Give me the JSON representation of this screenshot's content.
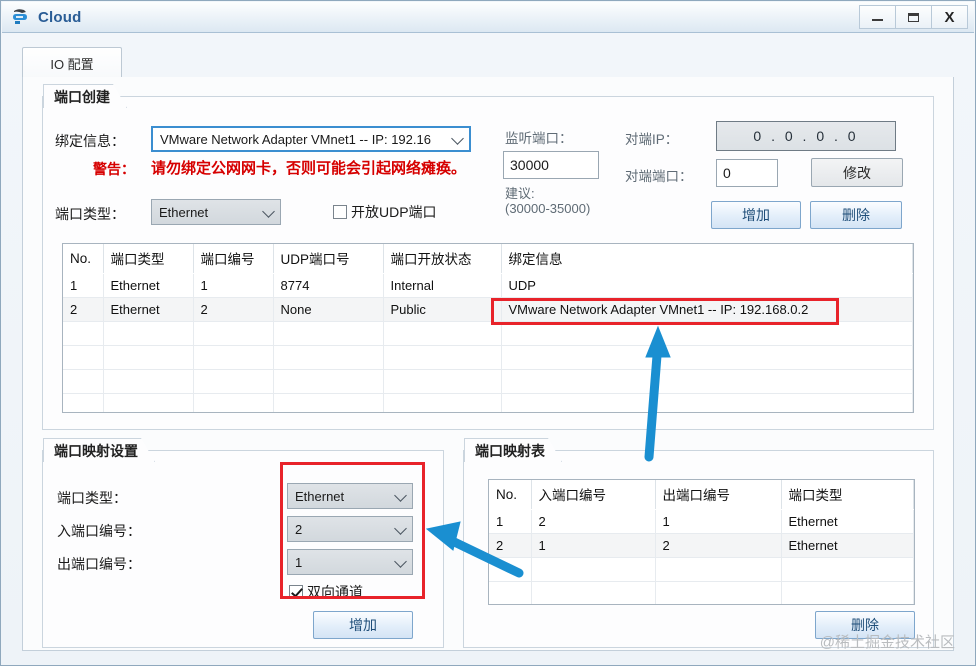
{
  "window": {
    "title": "Cloud",
    "icon": "cloud-icon",
    "controls": {
      "minimize": "minimize-icon",
      "maximize": "maximize-icon",
      "close": "X"
    }
  },
  "tabs": [
    {
      "label": "IO 配置",
      "active": true
    }
  ],
  "port_create": {
    "group_title": "端口创建",
    "bind_info_label": "绑定信息：",
    "bind_info_value": "VMware Network Adapter VMnet1 -- IP: 192.16",
    "warning_label": "警告：",
    "warning_text": "请勿绑定公网网卡，否则可能会引起网络瘫痪。",
    "port_type_label": "端口类型：",
    "port_type_value": "Ethernet",
    "udp_checkbox_label": "开放UDP端口",
    "udp_checkbox_checked": false,
    "listen_port_label": "监听端口：",
    "listen_port_value": "30000",
    "suggest_label_1": "建议:",
    "suggest_label_2": "(30000-35000)",
    "peer_ip_label": "对端IP：",
    "peer_ip_value": "0 . 0 . 0 . 0",
    "peer_port_label": "对端端口：",
    "peer_port_value": "0",
    "modify_button": "修改",
    "add_button": "增加",
    "delete_button": "删除"
  },
  "port_table": {
    "headers": [
      "No.",
      "端口类型",
      "端口编号",
      "UDP端口号",
      "端口开放状态",
      "绑定信息"
    ],
    "rows": [
      [
        "1",
        "Ethernet",
        "1",
        "8774",
        "Internal",
        "UDP"
      ],
      [
        "2",
        "Ethernet",
        "2",
        "None",
        "Public",
        "VMware Network Adapter VMnet1 -- IP: 192.168.0.2"
      ]
    ],
    "empty_rows": 4
  },
  "port_map_settings": {
    "group_title": "端口映射设置",
    "port_type_label": "端口类型：",
    "port_type_value": "Ethernet",
    "in_port_label": "入端口编号：",
    "in_port_value": "2",
    "out_port_label": "出端口编号：",
    "out_port_value": "1",
    "bidirectional_label": "双向通道",
    "bidirectional_checked": true,
    "add_button": "增加"
  },
  "port_map_table": {
    "group_title": "端口映射表",
    "headers": [
      "No.",
      "入端口编号",
      "出端口编号",
      "端口类型"
    ],
    "rows": [
      [
        "1",
        "2",
        "1",
        "Ethernet"
      ],
      [
        "2",
        "1",
        "2",
        "Ethernet"
      ]
    ],
    "empty_rows": 3,
    "delete_button": "删除"
  },
  "annotations": {
    "highlight_color": "#e8232a",
    "arrow_color": "#1a8fd1",
    "arrow_count": 2
  },
  "watermark": "@稀土掘金技术社区"
}
